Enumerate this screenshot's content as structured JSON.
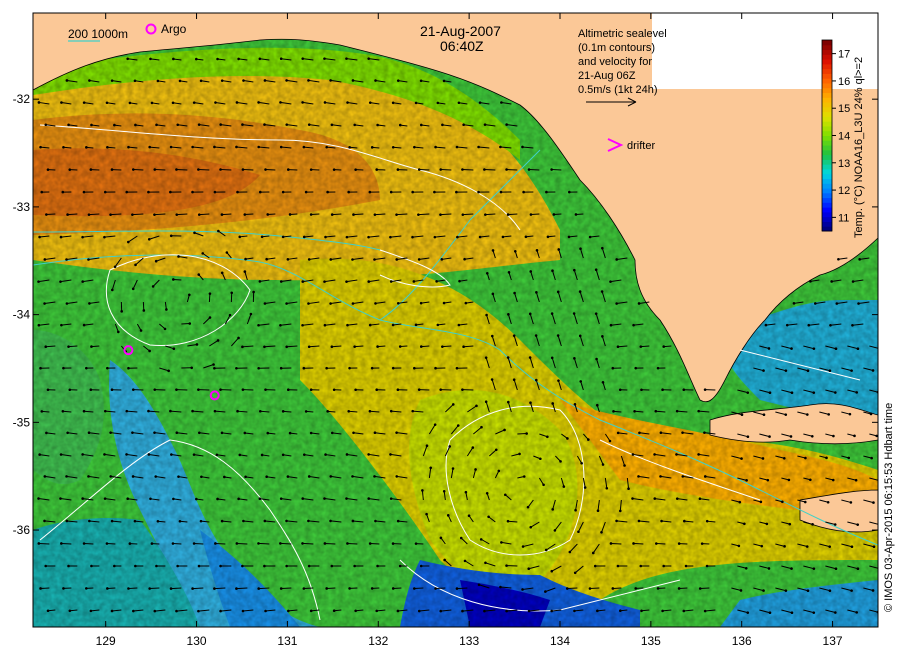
{
  "title": {
    "date": "21-Aug-2007",
    "time": "06:40Z"
  },
  "legend": {
    "contour_label": "200  1000m",
    "argo_label": "Argo",
    "drifter_label": "drifter",
    "altimetry_lines": [
      "Altimetric sealevel",
      "(0.1m contours)",
      "and velocity for",
      "21-Aug 06Z",
      "0.5m/s (1kt 24h)"
    ]
  },
  "colorbar": {
    "label": "Temp. (°C) NOAA16_L3U 24% ql>=2",
    "ticks": [
      "11",
      "12",
      "13",
      "14",
      "15",
      "16",
      "17"
    ],
    "min": 10.5,
    "max": 17.5,
    "colors": [
      "#00007f",
      "#0000ff",
      "#007fff",
      "#00d8e0",
      "#20c040",
      "#7fdf00",
      "#dfe000",
      "#ffb000",
      "#ff6000",
      "#dd1000",
      "#7f0000"
    ]
  },
  "credit": "© IMOS 03-Apr-2015 06:15:53 Hdbart time",
  "axes": {
    "x_ticks": [
      "129",
      "130",
      "131",
      "132",
      "133",
      "134",
      "135",
      "136",
      "137"
    ],
    "y_ticks": [
      "-32",
      "-33",
      "-34",
      "-35",
      "-36"
    ],
    "lon_range": [
      128.2,
      137.5
    ],
    "lat_range": [
      -36.9,
      -31.2
    ]
  },
  "argo_floats": [
    {
      "lon": 129.25,
      "lat": -34.33
    },
    {
      "lon": 130.2,
      "lat": -34.75
    }
  ],
  "colors": {
    "land": "#fbc897",
    "contour": "#40d0c8",
    "sealevel_contour": "#ffffff",
    "argo": "#ff00ff",
    "drifter": "#ff00ff"
  }
}
